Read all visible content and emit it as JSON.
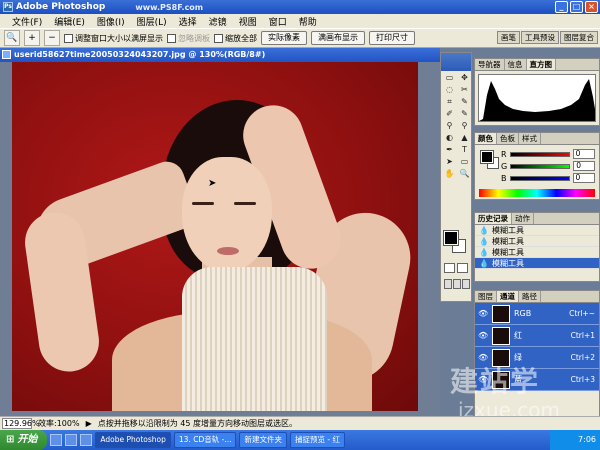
{
  "titlebar": {
    "title": "Adobe Photoshop",
    "watermark": "www.PS8F.com"
  },
  "menu": [
    "文件(F)",
    "编辑(E)",
    "图像(I)",
    "图层(L)",
    "选择",
    "滤镜",
    "视图",
    "窗口",
    "帮助"
  ],
  "options": {
    "resize_window": "调整窗口大小以满屏显示",
    "ignore_palettes": "忽略调板",
    "zoom_all": "缩放全部",
    "actual_pixels": "实际像素",
    "fit_screen": "满画布显示",
    "print_size": "打印尺寸"
  },
  "palette_well_tabs": [
    "画笔",
    "工具预设",
    "图层复合"
  ],
  "document": {
    "title": "userid58627time20050324043207.jpg @ 130%(RGB/8#)"
  },
  "tools": [
    "▭",
    "✥",
    "◌",
    "✂",
    "⌗",
    "✎",
    "✐",
    "✎",
    "⚲",
    "⚲",
    "◐",
    "▲",
    "✒",
    "T",
    "➤",
    "▭",
    "✋",
    "🔍"
  ],
  "navigator": {
    "tabs": [
      "导航器",
      "信息",
      "直方图"
    ]
  },
  "color": {
    "tabs": [
      "颜色",
      "色板",
      "样式"
    ],
    "channels": [
      {
        "label": "R",
        "value": "0",
        "color": "#ff0000"
      },
      {
        "label": "G",
        "value": "0",
        "color": "#00ff00"
      },
      {
        "label": "B",
        "value": "0",
        "color": "#0000ff"
      }
    ]
  },
  "history": {
    "tabs": [
      "历史记录",
      "动作"
    ],
    "items": [
      "模糊工具",
      "模糊工具",
      "模糊工具",
      "模糊工具"
    ]
  },
  "layers": {
    "tabs": [
      "图层",
      "通道",
      "路径"
    ],
    "channels": [
      {
        "name": "RGB",
        "shortcut": "Ctrl+~"
      },
      {
        "name": "红",
        "shortcut": "Ctrl+1"
      },
      {
        "name": "绿",
        "shortcut": "Ctrl+2"
      },
      {
        "name": "蓝",
        "shortcut": "Ctrl+3"
      }
    ]
  },
  "status": {
    "zoom": "129.96%",
    "efficiency": "效率:100%",
    "hint": "点按并拖移以沿限制为 45 度增量方向移动图层或选区。"
  },
  "taskbar": {
    "start": "开始",
    "tasks": [
      "Adobe Photoshop",
      "13. CD音轨 -...",
      "新建文件夹",
      "捕捉预览 - 红"
    ],
    "time": "7:06"
  },
  "watermark": {
    "big": "建站学",
    "small": "jzxue.com"
  }
}
